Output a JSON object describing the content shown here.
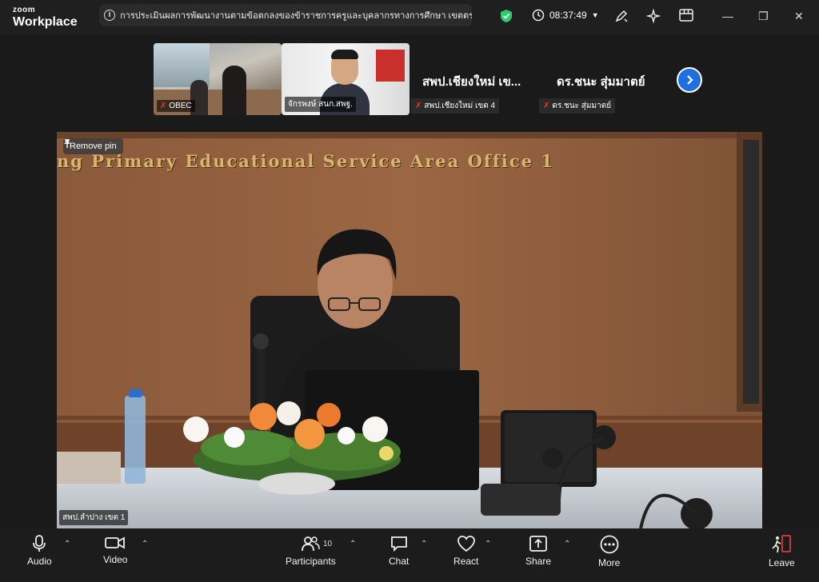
{
  "app": {
    "brand_small": "zoom",
    "brand_large": "Workplace",
    "meeting_topic": "การประเมินผลการพัฒนางานตามข้อตกลงของข้าราชการครูและบุคลากรทางการศึกษา เขตตรวจราชก",
    "clock": "08:37:49"
  },
  "strip": {
    "thumbs": [
      {
        "label": "OBEC",
        "muted": true
      },
      {
        "label": "จักรพงษ์ สนก.สพฐ.",
        "muted": false
      }
    ],
    "tiles": [
      {
        "name": "สพป.เชียงใหม่ เข...",
        "tag": "สพป.เชียงใหม่ เขต 4",
        "muted": true
      },
      {
        "name": "ดร.ชนะ สุ่มมาตย์",
        "tag": "ดร.ชนะ สุ่มมาตย์",
        "muted": true
      }
    ]
  },
  "main": {
    "remove_pin_label": "Remove pin",
    "wall_sign": "ng  Primary  Educational  Service  Area  Office  1",
    "speaker_name": "สพป.ลำปาง เขต 1"
  },
  "toolbar": {
    "audio": "Audio",
    "video": "Video",
    "participants": "Participants",
    "participant_count": "10",
    "chat": "Chat",
    "react": "React",
    "share": "Share",
    "more": "More",
    "leave": "Leave"
  },
  "colors": {
    "accent_blue": "#1f6fe0",
    "shield_green": "#2ecc71",
    "mute_red": "#e03a3a",
    "leave_red": "#e03a3a"
  }
}
